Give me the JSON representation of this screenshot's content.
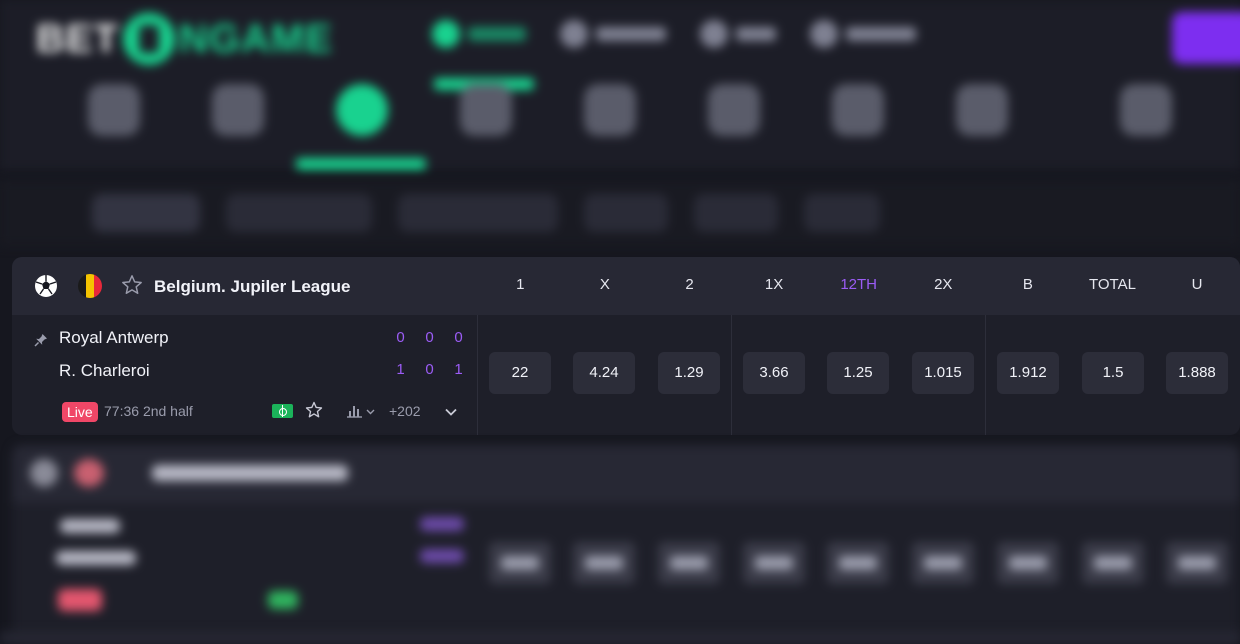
{
  "league": {
    "name": "Belgium. Jupiler League",
    "flag_colors": [
      "#1a1a1a",
      "#f5c400",
      "#e8283a"
    ]
  },
  "columns": [
    "1",
    "X",
    "2",
    "1X",
    "12TH",
    "2X",
    "B",
    "TOTAL",
    "U"
  ],
  "highlight_column": "12TH",
  "match": {
    "team_home": "Royal Antwerp",
    "team_away": "R. Charleroi",
    "scores_home": [
      "0",
      "0",
      "0"
    ],
    "scores_away": [
      "1",
      "0",
      "1"
    ],
    "status_badge": "Live",
    "time": "77:36",
    "period": "2nd half",
    "more_markets": "+202",
    "odds": [
      "22",
      "4.24",
      "1.29",
      "3.66",
      "1.25",
      "1.015",
      "1.912",
      "1.5",
      "1.888"
    ]
  },
  "colors": {
    "accent_purple": "#9b5cf5",
    "live_red": "#f04767",
    "brand_green": "#19d28f"
  }
}
